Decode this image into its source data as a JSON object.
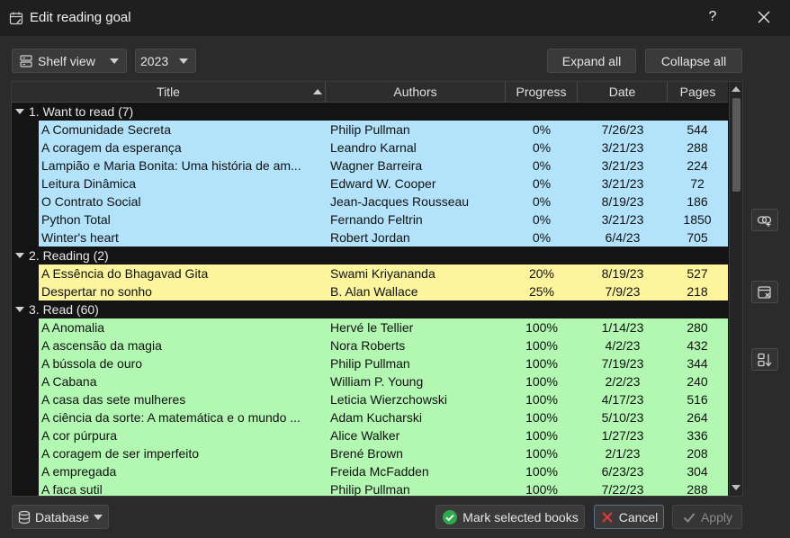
{
  "window": {
    "title": "Edit reading goal",
    "help_label": "?"
  },
  "toolbar": {
    "view_combo": "Shelf view",
    "year_combo": "2023",
    "expand_label": "Expand all",
    "collapse_label": "Collapse all"
  },
  "table": {
    "headers": {
      "title": "Title",
      "authors": "Authors",
      "progress": "Progress",
      "date": "Date",
      "pages": "Pages"
    },
    "groups": [
      {
        "label": "1. Want to read (7)",
        "color": "#b3e3fb",
        "rows": [
          {
            "title": "A Comunidade Secreta",
            "author": "Philip Pullman",
            "progress": "0%",
            "date": "7/26/23",
            "pages": "544"
          },
          {
            "title": "A coragem da esperança",
            "author": "Leandro Karnal",
            "progress": "0%",
            "date": "3/21/23",
            "pages": "288"
          },
          {
            "title": "Lampião e Maria Bonita: Uma história de am...",
            "author": "Wagner Barreira",
            "progress": "0%",
            "date": "3/21/23",
            "pages": "224"
          },
          {
            "title": "Leitura Dinâmica",
            "author": "Edward W. Cooper",
            "progress": "0%",
            "date": "3/21/23",
            "pages": "72"
          },
          {
            "title": "O Contrato Social",
            "author": "Jean-Jacques Rousseau",
            "progress": "0%",
            "date": "8/19/23",
            "pages": "186"
          },
          {
            "title": "Python Total",
            "author": "Fernando Feltrin",
            "progress": "0%",
            "date": "3/21/23",
            "pages": "1850"
          },
          {
            "title": "Winter's heart",
            "author": "Robert Jordan",
            "progress": "0%",
            "date": "6/4/23",
            "pages": "705"
          }
        ]
      },
      {
        "label": "2. Reading (2)",
        "color": "#fcf59d",
        "rows": [
          {
            "title": "A Essência do Bhagavad Gita",
            "author": "Swami Kriyananda",
            "progress": "20%",
            "date": "8/19/23",
            "pages": "527"
          },
          {
            "title": "Despertar no sonho",
            "author": "B. Alan Wallace",
            "progress": "25%",
            "date": "7/9/23",
            "pages": "218"
          }
        ]
      },
      {
        "label": "3. Read (60)",
        "color": "#b2f8b2",
        "rows": [
          {
            "title": "A Anomalia",
            "author": "Hervé le Tellier",
            "progress": "100%",
            "date": "1/14/23",
            "pages": "280"
          },
          {
            "title": "A ascensão da magia",
            "author": "Nora Roberts",
            "progress": "100%",
            "date": "4/2/23",
            "pages": "432"
          },
          {
            "title": "A bússola de ouro",
            "author": "Philip Pullman",
            "progress": "100%",
            "date": "7/19/23",
            "pages": "344"
          },
          {
            "title": "A Cabana",
            "author": "William P. Young",
            "progress": "100%",
            "date": "2/2/23",
            "pages": "240"
          },
          {
            "title": "A casa das sete mulheres",
            "author": "Leticia Wierzchowski",
            "progress": "100%",
            "date": "4/17/23",
            "pages": "516"
          },
          {
            "title": "A ciência da sorte: A matemática e o mundo ...",
            "author": "Adam Kucharski",
            "progress": "100%",
            "date": "5/10/23",
            "pages": "264"
          },
          {
            "title": "A cor púrpura",
            "author": "Alice Walker",
            "progress": "100%",
            "date": "1/27/23",
            "pages": "336"
          },
          {
            "title": "A coragem de ser imperfeito",
            "author": "Brené Brown",
            "progress": "100%",
            "date": "2/1/23",
            "pages": "208"
          },
          {
            "title": "A empregada",
            "author": "Freida McFadden",
            "progress": "100%",
            "date": "6/23/23",
            "pages": "304"
          },
          {
            "title": "A faca sutil",
            "author": "Philip Pullman",
            "progress": "100%",
            "date": "7/22/23",
            "pages": "288"
          }
        ]
      }
    ]
  },
  "footer": {
    "database_label": "Database",
    "mark_label": "Mark selected books",
    "cancel_label": "Cancel",
    "apply_label": "Apply"
  },
  "colors": {
    "want_to_read": "#b3e3fb",
    "reading": "#fcf59d",
    "read": "#b2f8b2",
    "mark_icon": "#2fa84f",
    "cancel_icon": "#e03a3a"
  },
  "icons": {
    "titlebar": "calendar-edit-icon",
    "close": "close-icon",
    "view": "shelf-view-icon",
    "side_1": "link-add-icon",
    "side_2": "calendar-remove-icon",
    "side_3": "sort-icon",
    "database": "database-icon",
    "mark": "check-circle-icon",
    "cancel": "cancel-x-icon",
    "apply": "check-icon"
  }
}
